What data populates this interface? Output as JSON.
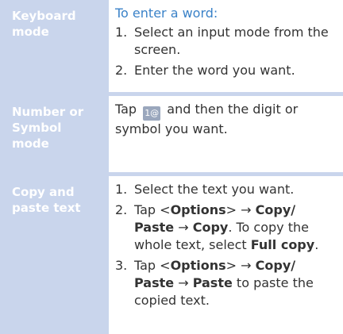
{
  "colors": {
    "label_bg": "#c9d5ec",
    "label_text": "#ffffff",
    "heading": "#3a82c8",
    "body_text": "#333333",
    "icon_bg": "#9aa7bd"
  },
  "rows": {
    "keyboard": {
      "label": "Keyboard\nmode",
      "heading": "To enter a word:",
      "steps": [
        {
          "num": "1.",
          "text": "Select an input mode from the screen."
        },
        {
          "num": "2.",
          "text": "Enter the word you want."
        }
      ]
    },
    "number": {
      "label": "Number or\nSymbol\nmode",
      "text_before": "Tap",
      "icon_label": "1@",
      "icon_name": "number-symbol-key-icon",
      "text_after": "and then the digit or symbol you want."
    },
    "copy": {
      "label": "Copy and\npaste text",
      "step1": {
        "num": "1.",
        "text": "Select the text you want."
      },
      "step2": {
        "num": "2.",
        "t1": "Tap <",
        "options": "Options",
        "t2": "> → ",
        "copy_paste": "Copy/ Paste",
        "arrow": " → ",
        "copy": "Copy",
        "t3": ". To copy the whole text, select ",
        "full_copy": "Full copy",
        "t4": "."
      },
      "step3": {
        "num": "3.",
        "t1": "Tap <",
        "options": "Options",
        "t2": "> → ",
        "copy_paste": "Copy/ Paste",
        "arrow": " → ",
        "paste": "Paste",
        "t3": " to paste the copied text."
      }
    }
  }
}
